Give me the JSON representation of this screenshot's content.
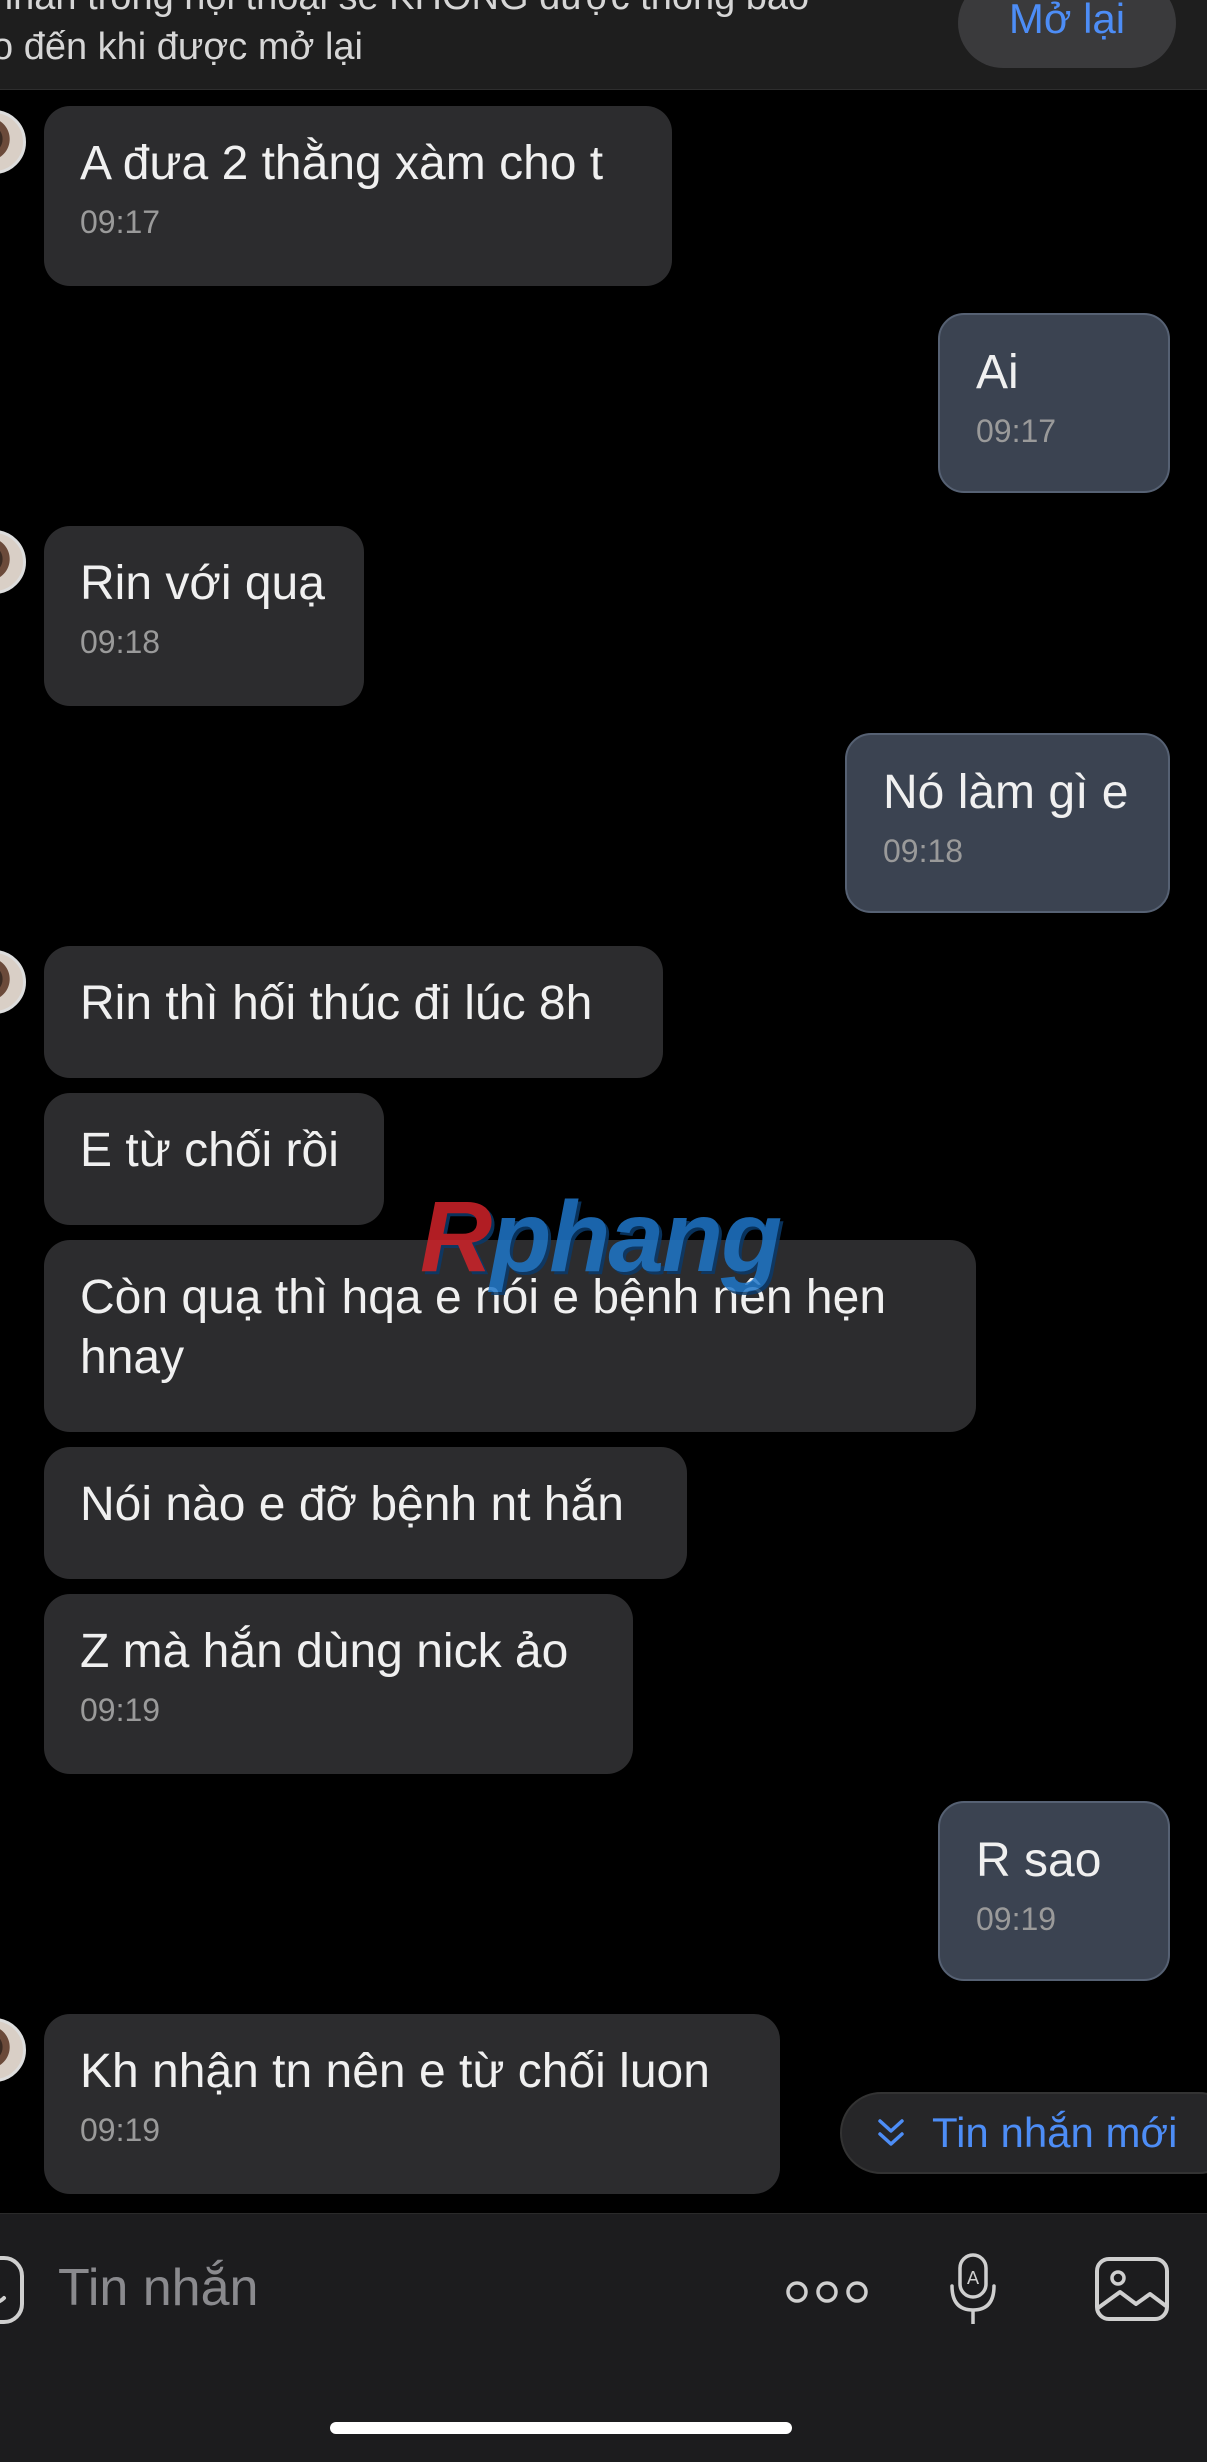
{
  "banner": {
    "line1": "nhắn trong hội thoại sẽ KHÔNG được thông báo",
    "line2": "o đến khi được mở lại",
    "reopen_label": "Mở lại"
  },
  "messages": [
    {
      "side": "in",
      "text": "A đưa 2 thằng xàm cho t",
      "time": "09:17"
    },
    {
      "side": "out",
      "text": "Ai",
      "time": "09:17"
    },
    {
      "side": "in",
      "text": "Rin với quạ",
      "time": "09:18"
    },
    {
      "side": "out",
      "text": "Nó làm gì e",
      "time": "09:18"
    },
    {
      "side": "in",
      "text": "Rin thì hối thúc đi lúc 8h",
      "time": ""
    },
    {
      "side": "in",
      "text": "E từ chối rồi",
      "time": ""
    },
    {
      "side": "in",
      "text": "Còn quạ thì hqa e nói e bệnh nên hẹn\nhnay",
      "time": ""
    },
    {
      "side": "in",
      "text": "Nói nào e đỡ bệnh nt hắn",
      "time": ""
    },
    {
      "side": "in",
      "text": "Z mà hắn dùng nick ảo",
      "time": "09:19"
    },
    {
      "side": "out",
      "text": "R sao",
      "time": "09:19"
    },
    {
      "side": "in",
      "text": "Kh nhận tn nên e từ chối luon",
      "time": "09:19"
    }
  ],
  "new_messages_label": "Tin nhắn mới",
  "composer": {
    "placeholder": "Tin nhắn",
    "icons": [
      "sticker-icon",
      "more-icon",
      "mic-icon",
      "image-icon"
    ]
  },
  "watermark": {
    "first": "R",
    "rest": "phang"
  },
  "colors": {
    "accent": "#4d8df6",
    "incoming_bubble": "#2c2c2e",
    "outgoing_bubble": "#3b4351",
    "background": "#000000"
  }
}
